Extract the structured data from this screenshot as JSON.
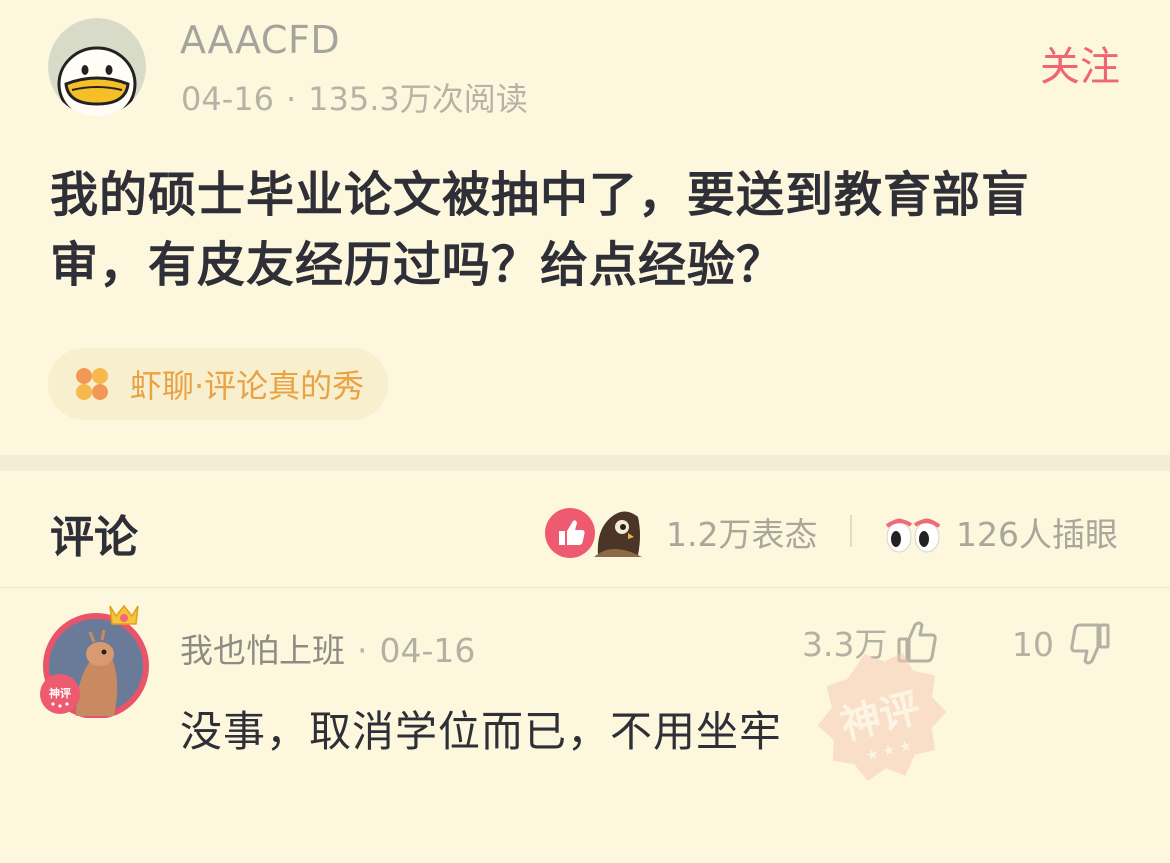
{
  "post": {
    "author": "AAACFD",
    "date": "04-16",
    "separator": "·",
    "reads": "135.3万次阅读",
    "follow_label": "关注",
    "title": "我的硕士毕业论文被抽中了，要送到教育部盲审，有皮友经历过吗？给点经验？",
    "topic_tag": "虾聊·评论真的秀"
  },
  "comments_section": {
    "title": "评论",
    "reactions_count": "1.2万表态",
    "watchers_count": "126人插眼"
  },
  "comments": [
    {
      "author": "我也怕上班",
      "separator": "·",
      "date": "04-16",
      "likes": "3.3万",
      "dislikes": "10",
      "text": "没事，取消学位而已，不用坐牢",
      "avatar_badge": "神评",
      "stamp": "神评"
    }
  ],
  "colors": {
    "background": "#fdf8dd",
    "accent_pink": "#ef6672",
    "tag_orange": "#eaa343"
  },
  "icons": {
    "author_avatar": "duck-face-icon",
    "topic": "clover-icon",
    "reaction_like": "thumbs-up-icon",
    "reaction_owl": "owl-icon",
    "watchers": "eyes-icon",
    "comment_like": "thumbs-up-outline-icon",
    "comment_dislike": "thumbs-down-outline-icon"
  }
}
